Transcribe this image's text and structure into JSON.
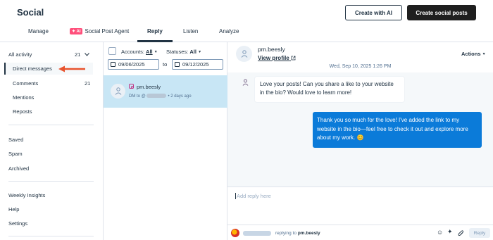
{
  "header": {
    "title": "Social",
    "create_with_ai": "Create with AI",
    "create_posts": "Create social posts"
  },
  "tabs": [
    {
      "label": "Manage"
    },
    {
      "label": "Social Post Agent",
      "badge": "AI"
    },
    {
      "label": "Reply",
      "active": true
    },
    {
      "label": "Listen"
    },
    {
      "label": "Analyze"
    }
  ],
  "sidebar": {
    "all_activity": "All activity",
    "all_activity_count": "21",
    "direct_messages": "Direct messages",
    "comments": "Comments",
    "comments_count": "21",
    "mentions": "Mentions",
    "reposts": "Reposts",
    "saved": "Saved",
    "spam": "Spam",
    "archived": "Archived",
    "weekly_insights": "Weekly Insights",
    "help": "Help",
    "settings": "Settings"
  },
  "filters": {
    "accounts_label": "Accounts:",
    "accounts_value": "All",
    "statuses_label": "Statuses:",
    "statuses_value": "All",
    "date_from": "09/06/2025",
    "date_to_label": "to",
    "date_to": "09/12/2025"
  },
  "conversation": {
    "name": "pm.beesly",
    "meta_prefix": "DM to @",
    "meta_time": "• 2 days ago"
  },
  "detail": {
    "name": "pm.beesly",
    "view_profile": "View profile",
    "actions": "Actions",
    "timestamp": "Wed, Sep 10, 2025 1:26 PM",
    "incoming_message": "Love your posts! Can you share a like to your website in the bio? Would love to learn more!",
    "outgoing_message": "Thank you so much for the love! I've added the link to my website in the bio—feel free to check it out and explore more about my work. 😊",
    "reply_placeholder": "Add reply here",
    "replying_prefix": "replying to",
    "replying_to": "pm.beesly",
    "reply_button": "Reply"
  },
  "colors": {
    "accent_blue": "#0b7bd9",
    "selected_row": "#c8e6f5",
    "arrow": "#e8542e",
    "ai_badge": "#ff4f7b"
  }
}
